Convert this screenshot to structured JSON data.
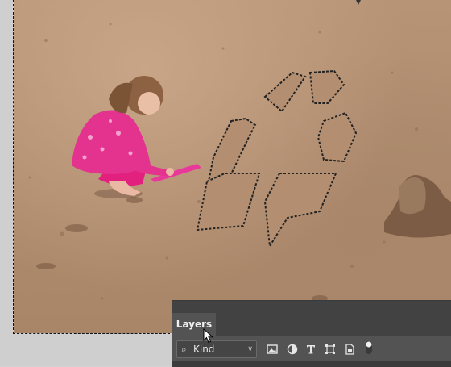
{
  "layers_panel": {
    "tab_label": "Layers",
    "filter_select": {
      "value": "Kind",
      "icon": "search-icon"
    },
    "filter_icons": [
      "image-filter-icon",
      "adjustment-filter-icon",
      "type-filter-icon",
      "shape-filter-icon",
      "smart-object-filter-icon",
      "filter-toggle-icon"
    ]
  },
  "colors": {
    "guide": "#36d6d0",
    "panel_bg": "#535353",
    "panel_header": "#424242"
  }
}
